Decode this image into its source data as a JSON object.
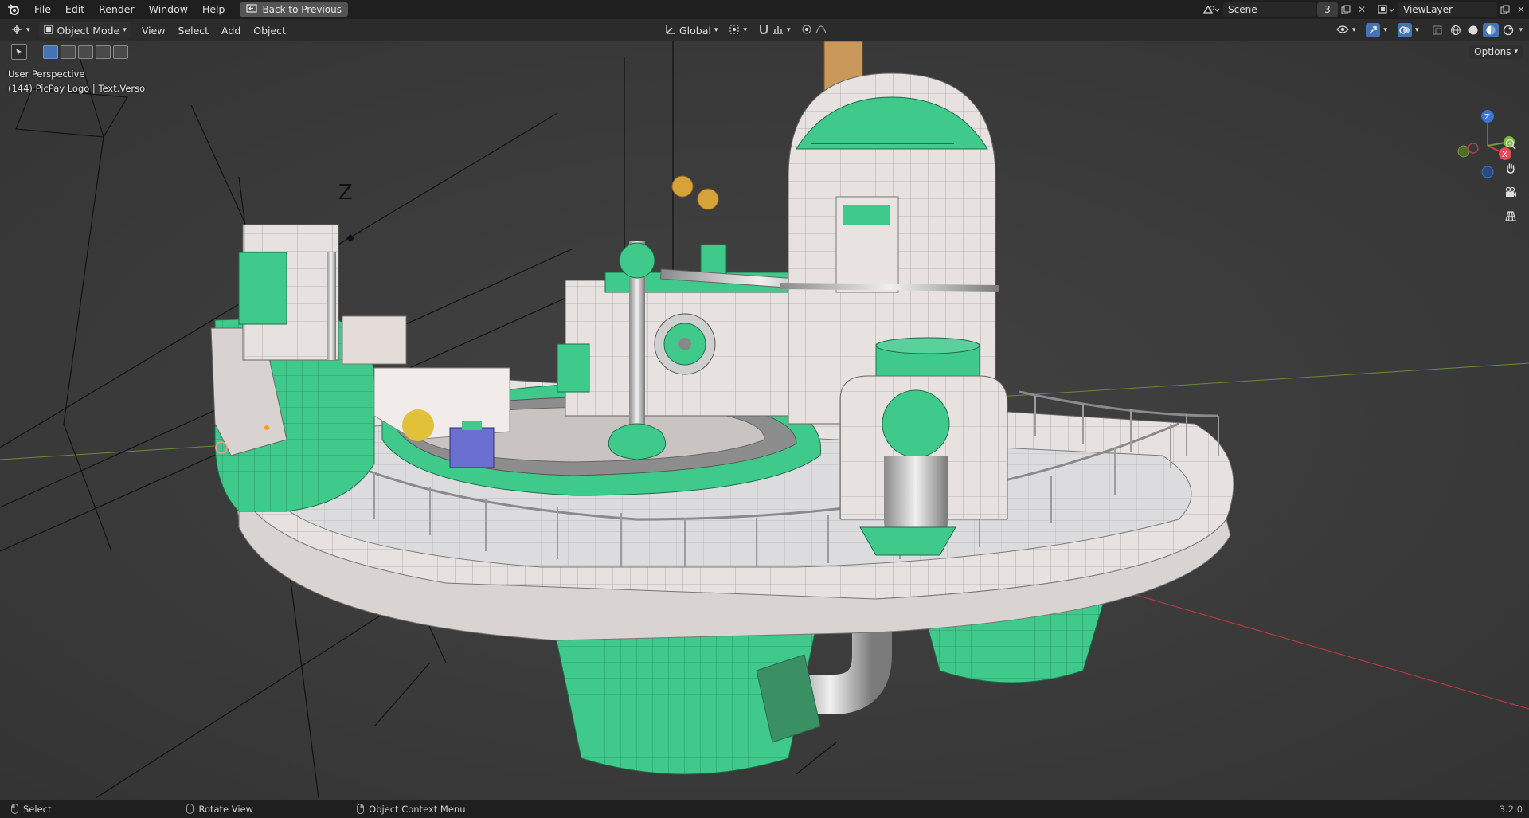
{
  "menubar": {
    "items": [
      "File",
      "Edit",
      "Render",
      "Window",
      "Help"
    ],
    "back_label": "Back to Previous",
    "scene_name": "Scene",
    "scene_users": "3",
    "viewlayer_name": "ViewLayer"
  },
  "header": {
    "mode_label": "Object Mode",
    "menus": [
      "View",
      "Select",
      "Add",
      "Object"
    ],
    "transform_orientation": "Global",
    "options_label": "Options"
  },
  "viewport": {
    "view_name": "User Perspective",
    "active_object": "(144) PicPay Logo | Text.Verso",
    "gizmo_axes": [
      "Z",
      "X",
      "Y"
    ]
  },
  "statusbar": {
    "select_label": "Select",
    "rotate_label": "Rotate View",
    "context_label": "Object Context Menu",
    "version": "3.2.0"
  },
  "colors": {
    "accent_blue": "#4772b3",
    "model_green": "#3ec98a",
    "model_white": "#e9e3e1",
    "axis_red": "#c0363c",
    "axis_green": "#6a9a2f"
  }
}
